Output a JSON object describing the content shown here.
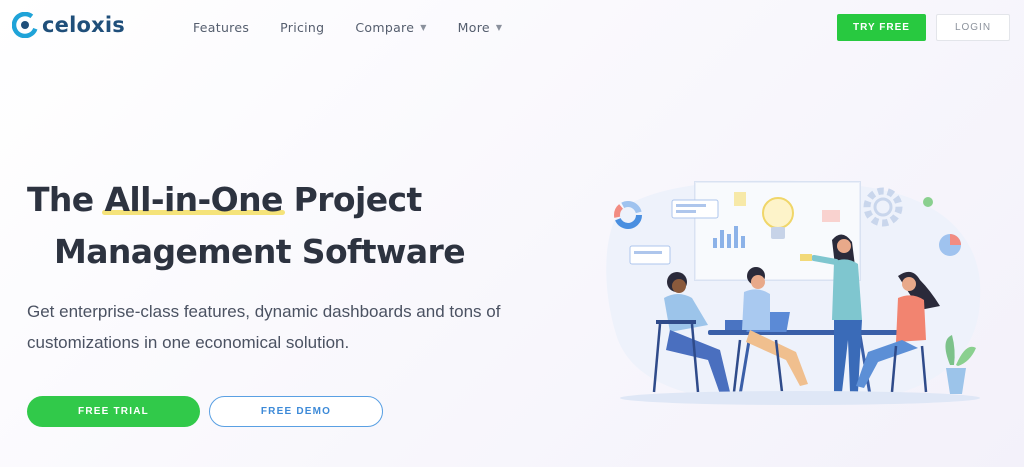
{
  "header": {
    "logo_text": "celoxis",
    "nav": [
      {
        "label": "Features",
        "has_caret": false
      },
      {
        "label": "Pricing",
        "has_caret": false
      },
      {
        "label": "Compare",
        "has_caret": true
      },
      {
        "label": "More",
        "has_caret": true
      }
    ],
    "try_free_label": "TRY FREE",
    "login_label": "LOGIN"
  },
  "hero": {
    "title_part1": "The ",
    "title_highlight": "All-in-One",
    "title_part2": " Project",
    "title_line2": "Management Software",
    "subtitle_line1": "Get enterprise-class features, dynamic dashboards and tons of",
    "subtitle_line2": "customizations in one economical solution.",
    "free_trial_label": "FREE TRIAL",
    "free_demo_label": "FREE DEMO"
  },
  "colors": {
    "brand_blue": "#1f4f7a",
    "accent_green": "#28c940",
    "demo_blue": "#3d8ad8",
    "highlight_yellow": "#f5e37a"
  },
  "icons": [
    "celoxis-logo-icon",
    "caret-down-icon",
    "team-meeting-illustration"
  ]
}
